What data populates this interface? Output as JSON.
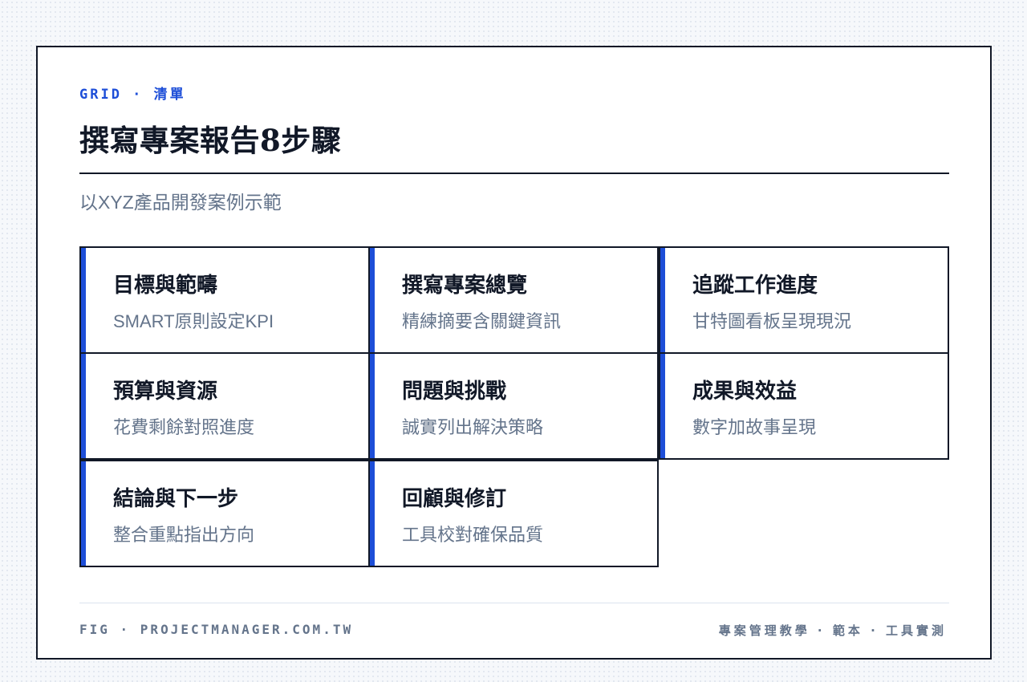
{
  "header": {
    "eyebrow": "GRID · 清單",
    "title": "撰寫專案報告8步驟",
    "subtitle": "以XYZ產品開發案例示範"
  },
  "steps": [
    {
      "title": "目標與範疇",
      "desc": "SMART原則設定KPI"
    },
    {
      "title": "撰寫專案總覽",
      "desc": "精練摘要含關鍵資訊"
    },
    {
      "title": "追蹤工作進度",
      "desc": "甘特圖看板呈現現況"
    },
    {
      "title": "預算與資源",
      "desc": "花費剩餘對照進度"
    },
    {
      "title": "問題與挑戰",
      "desc": "誠實列出解決策略"
    },
    {
      "title": "成果與效益",
      "desc": "數字加故事呈現"
    },
    {
      "title": "結論與下一步",
      "desc": "整合重點指出方向"
    },
    {
      "title": "回顧與修訂",
      "desc": "工具校對確保品質"
    }
  ],
  "footer": {
    "left": "FIG · PROJECTMANAGER.COM.TW",
    "right": "專案管理教學 · 範本 · 工具實測"
  },
  "colors": {
    "accent": "#1d4ed8",
    "ink": "#111827",
    "muted": "#64748b"
  }
}
